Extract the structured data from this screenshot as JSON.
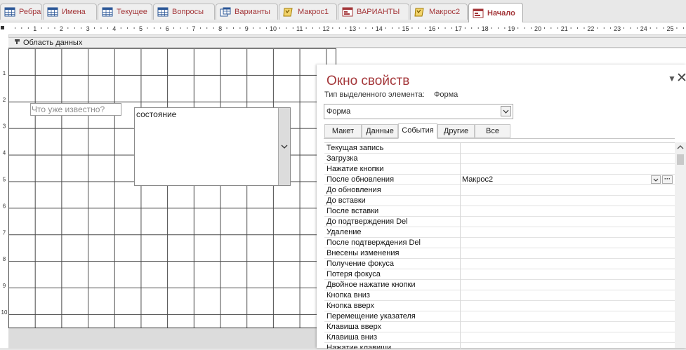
{
  "tabs": [
    {
      "label": "Ребра",
      "icon": "table-icon",
      "active": false
    },
    {
      "label": "Имена",
      "icon": "table-icon",
      "active": false
    },
    {
      "label": "Текущее",
      "icon": "table-icon",
      "active": false
    },
    {
      "label": "Вопросы",
      "icon": "table-icon",
      "active": false
    },
    {
      "label": "Варианты",
      "icon": "query-icon",
      "active": false
    },
    {
      "label": "Макрос1",
      "icon": "macro-icon",
      "active": false
    },
    {
      "label": "ВАРИАНТЫ",
      "icon": "form-icon",
      "active": false
    },
    {
      "label": "Макрос2",
      "icon": "macro-icon",
      "active": false
    },
    {
      "label": "Начало",
      "icon": "form-icon",
      "active": true
    }
  ],
  "ruler": {
    "numbers": [
      "1",
      "2",
      "3",
      "4",
      "5",
      "6",
      "7",
      "8",
      "9",
      "10",
      "11",
      "12",
      "13",
      "14",
      "15",
      "16",
      "17",
      "18",
      "19",
      "20",
      "21",
      "22",
      "23",
      "24",
      "25"
    ]
  },
  "left_ruler": {
    "numbers": [
      "1",
      "2",
      "3",
      "4",
      "5",
      "6",
      "7",
      "8",
      "9",
      "10"
    ]
  },
  "section": {
    "label": "Область данных"
  },
  "form": {
    "label_text": "Что уже известно?",
    "combo_text": "состояние"
  },
  "props": {
    "title": "Окно свойств",
    "selection_type_label": "Тип выделенного элемента:",
    "selection_type_value": "Форма",
    "object_select": "Форма",
    "tabs": [
      {
        "label": "Макет",
        "active": false
      },
      {
        "label": "Данные",
        "active": false
      },
      {
        "label": "События",
        "active": true
      },
      {
        "label": "Другие",
        "active": false
      },
      {
        "label": "Все",
        "active": false
      }
    ],
    "rows": [
      {
        "name": "Текущая запись",
        "value": ""
      },
      {
        "name": "Загрузка",
        "value": ""
      },
      {
        "name": "Нажатие кнопки",
        "value": ""
      },
      {
        "name": "После обновления",
        "value": "Макрос2",
        "selected": true
      },
      {
        "name": "До обновления",
        "value": ""
      },
      {
        "name": "До вставки",
        "value": ""
      },
      {
        "name": "После вставки",
        "value": ""
      },
      {
        "name": "До подтверждения Del",
        "value": ""
      },
      {
        "name": "Удаление",
        "value": ""
      },
      {
        "name": "После подтверждения Del",
        "value": ""
      },
      {
        "name": "Внесены изменения",
        "value": ""
      },
      {
        "name": "Получение фокуса",
        "value": ""
      },
      {
        "name": "Потеря фокуса",
        "value": ""
      },
      {
        "name": "Двойное нажатие кнопки",
        "value": ""
      },
      {
        "name": "Кнопка вниз",
        "value": ""
      },
      {
        "name": "Кнопка вверх",
        "value": ""
      },
      {
        "name": "Перемещение указателя",
        "value": ""
      },
      {
        "name": "Клавиша вверх",
        "value": ""
      },
      {
        "name": "Клавиша вниз",
        "value": ""
      },
      {
        "name": "Нажатие клавиши",
        "value": ""
      }
    ]
  },
  "colors": {
    "accent": "#a4373a",
    "grid_line": "#4a4a4a"
  }
}
